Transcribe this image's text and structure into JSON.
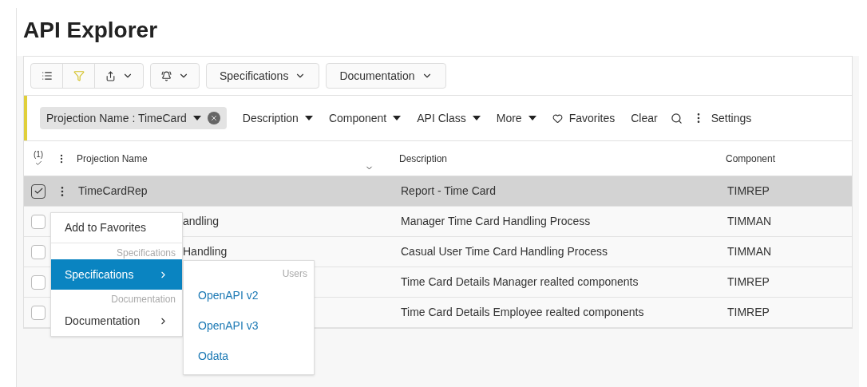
{
  "page": {
    "title": "API Explorer"
  },
  "toolbar": {
    "buttons": [
      {
        "label": "Specifications"
      },
      {
        "label": "Documentation"
      }
    ]
  },
  "filters": {
    "chip": {
      "label": "Projection Name : TimeCard"
    },
    "items": [
      {
        "label": "Description"
      },
      {
        "label": "Component"
      },
      {
        "label": "API Class"
      },
      {
        "label": "More"
      }
    ],
    "favorites": "Favorites",
    "clear": "Clear",
    "settings": "Settings"
  },
  "table": {
    "selected_count": "(1)",
    "columns": [
      "Projection Name",
      "Description",
      "Component"
    ],
    "rows": [
      {
        "name": "TimeCardRep",
        "description": "Report - Time Card",
        "component": "TIMREP",
        "selected": true
      },
      {
        "name": "andling",
        "description": "Manager Time Card Handling Process",
        "component": "TIMMAN",
        "selected": false
      },
      {
        "name": "Handling",
        "description": "Casual User Time Card Handling Process",
        "component": "TIMMAN",
        "selected": false
      },
      {
        "description": "Time Card Details Manager realted components",
        "component": "TIMREP",
        "selected": false
      },
      {
        "description": "Time Card Details Employee realted components",
        "component": "TIMREP",
        "selected": false
      }
    ]
  },
  "context_menu": {
    "items": [
      {
        "kind": "item",
        "label": "Add to Favorites"
      },
      {
        "kind": "group",
        "label": "Specifications"
      },
      {
        "kind": "submenu",
        "label": "Specifications",
        "selected": true
      },
      {
        "kind": "group",
        "label": "Documentation"
      },
      {
        "kind": "submenu",
        "label": "Documentation",
        "selected": false
      }
    ],
    "submenu": {
      "group": "Users",
      "items": [
        "OpenAPI v2",
        "OpenAPI v3",
        "Odata"
      ]
    }
  }
}
